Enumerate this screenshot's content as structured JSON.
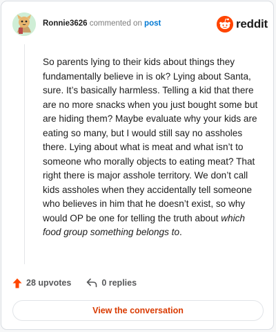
{
  "comment": {
    "username": "Ronnie3626",
    "verb": "commented on",
    "target": "post",
    "body_paragraph": "So parents lying to their kids about things they fundamentally believe in is ok? Lying about Santa, sure. It’s basically harmless. Telling a kid that there are no more snacks when you just bought some but are hiding them? Maybe evaluate why your kids are eating so many, but I would still say no assholes there. Lying about what is meat and what isn’t to someone who morally objects to eating meat? That right there is major asshole territory. We don’t call kids assholes when they accidentally tell someone who believes in him that he doesn’t exist, so why would OP be one for telling the truth about ",
    "body_italic": "which food group something belongs to",
    "body_end": "."
  },
  "brand": {
    "wordmark": "reddit",
    "color": "#ff4500",
    "icon": "reddit-logo-icon"
  },
  "actions": {
    "upvotes_label": "28 upvotes",
    "replies_label": "0 replies",
    "upvote_icon": "upvote-arrow-icon",
    "reply_icon": "reply-arrow-icon",
    "upvote_color": "#ff4500"
  },
  "cta": {
    "label": "View the conversation",
    "color": "#d93a00"
  }
}
